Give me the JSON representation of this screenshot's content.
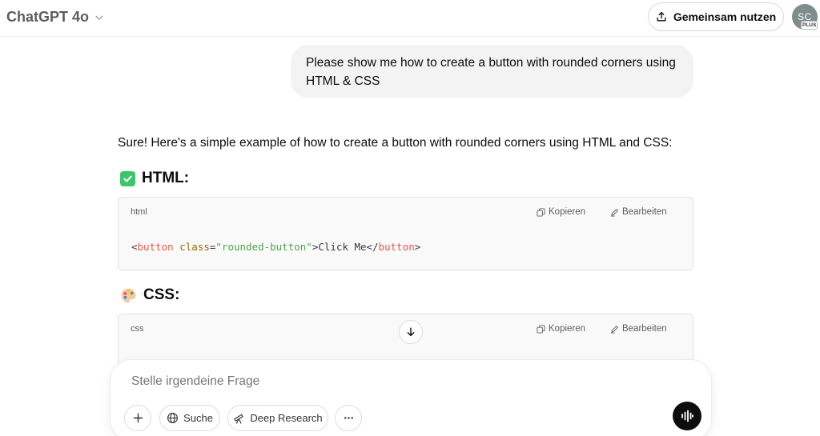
{
  "header": {
    "model_name": "ChatGPT 4o",
    "share_label": "Gemeinsam nutzen",
    "avatar_initials": "SC",
    "plan_badge": "PLUS"
  },
  "conversation": {
    "user_message": "Please show me how to create a button with rounded corners using HTML & CSS",
    "assistant_intro": "Sure! Here's a simple example of how to create a button with rounded corners using HTML and CSS:",
    "sections": [
      {
        "icon": "check-mark-icon",
        "heading": "HTML:",
        "language": "html",
        "copy_label": "Kopieren",
        "edit_label": "Bearbeiten",
        "code": {
          "open_bracket": "<",
          "tag": "button",
          "attr": "class",
          "equals": "=",
          "value": "\"rounded-button\"",
          "text": ">Click Me</",
          "close_tag": "button",
          "end": ">"
        }
      },
      {
        "icon": "palette-icon",
        "heading": "CSS:",
        "language": "css",
        "copy_label": "Kopieren",
        "edit_label": "Bearbeiten"
      }
    ]
  },
  "composer": {
    "placeholder": "Stelle irgendeine Frage",
    "search_label": "Suche",
    "deep_research_label": "Deep Research"
  },
  "colors": {
    "accent_check": "#3ec46d",
    "bubble_bg": "#f3f3f3",
    "code_bg": "#f9f9f9",
    "code_tag": "#e45649",
    "code_attr": "#986801",
    "code_string": "#50a14f"
  }
}
